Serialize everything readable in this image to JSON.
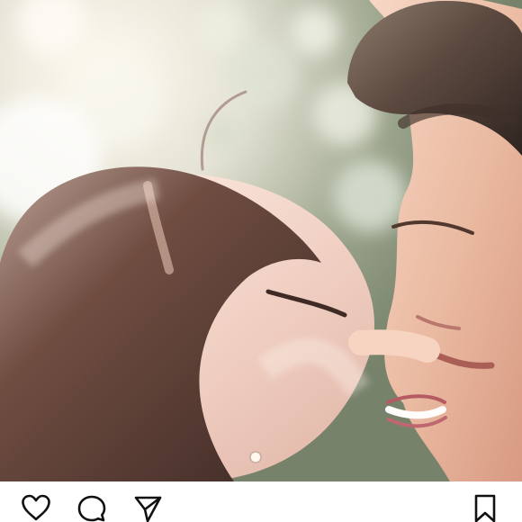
{
  "post": {
    "image": {
      "subject": "couple-photo",
      "accent_colors": {
        "background": "#8a9376",
        "hair": "#5e3e31",
        "skin": "#efc6b1",
        "highlight": "#fff8ec"
      }
    },
    "actions": {
      "like_icon": "heart-icon",
      "comment_icon": "comment-icon",
      "share_icon": "send-icon",
      "save_icon": "bookmark-icon"
    }
  }
}
